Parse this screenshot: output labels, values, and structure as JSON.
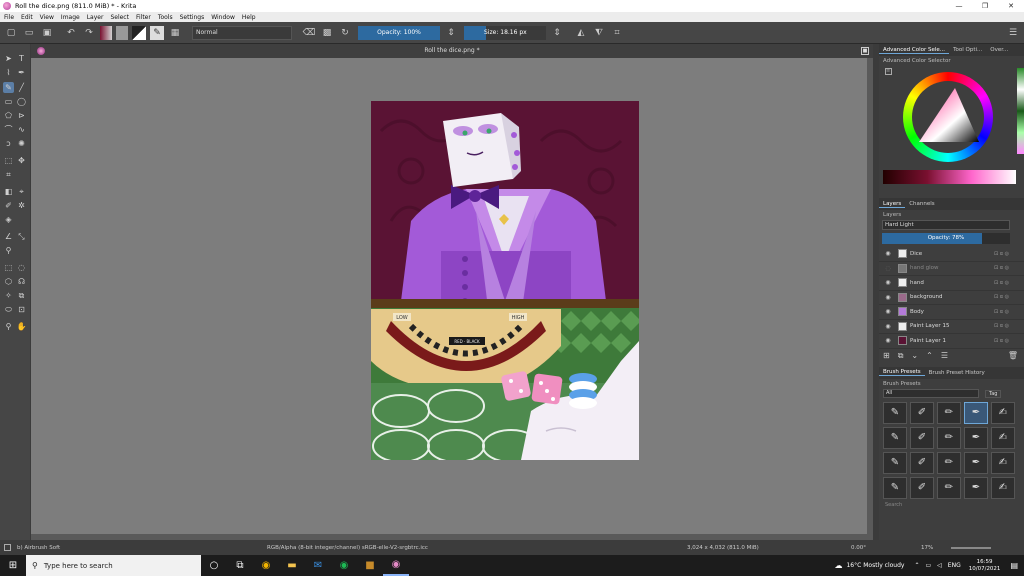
{
  "window": {
    "title": "Roll the dice.png (811.0 MiB)  * - Krita",
    "minimize": "—",
    "maximize": "❐",
    "close": "✕"
  },
  "menu": [
    "File",
    "Edit",
    "View",
    "Image",
    "Layer",
    "Select",
    "Filter",
    "Tools",
    "Settings",
    "Window",
    "Help"
  ],
  "toolbar": {
    "blend_mode": "Normal",
    "opacity": "Opacity: 100%",
    "size": "Size: 18.16 px"
  },
  "document_tab": "Roll the dice.png *",
  "right_dock": {
    "top_tabs": [
      "Advanced Color Sele...",
      "Tool Opti...",
      "Over..."
    ],
    "color_selector_title": "Advanced Color Selector",
    "layer_tabs": [
      "Layers",
      "Channels"
    ],
    "layers_title": "Layers",
    "layer_blend": "Hard Light",
    "layer_opacity": "Opacity: 78%",
    "layers": [
      {
        "name": "Dice",
        "dim": false
      },
      {
        "name": "hand glow",
        "dim": true
      },
      {
        "name": "hand",
        "dim": false
      },
      {
        "name": "background",
        "dim": false
      },
      {
        "name": "Body",
        "dim": false
      },
      {
        "name": "Paint Layer 15",
        "dim": false
      },
      {
        "name": "Paint Layer 1",
        "dim": false
      }
    ],
    "brush_tabs": [
      "Brush Presets",
      "Brush Preset History"
    ],
    "brush_presets_title": "Brush Presets",
    "brush_filter": "All",
    "tag_label": "Tag",
    "search_placeholder": "Search"
  },
  "artwork": {
    "board_low": "LOW",
    "board_high": "HIGH",
    "board_center": "RED · BLACK"
  },
  "status": {
    "brush": "b) Airbrush Soft",
    "color_info": "RGB/Alpha (8-bit integer/channel)  sRGB-elle-V2-srgbtrc.icc",
    "dimensions": "3,024 x 4,032 (811.0 MiB)",
    "rotation": "0.00°",
    "zoom": "17%"
  },
  "taskbar": {
    "search_placeholder": "Type here to search",
    "weather": "16°C  Mostly cloudy",
    "lang": "ENG",
    "time": "16:59",
    "date": "10/07/2021"
  },
  "colors": {
    "accent": "#2d6aa0",
    "bg_maroon": "#5a1334",
    "table_green": "#4e8a4e",
    "suit_purple": "#a35ad8"
  }
}
